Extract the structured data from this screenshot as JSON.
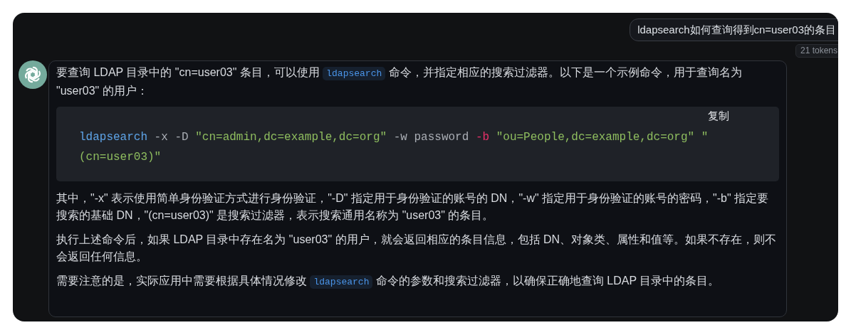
{
  "user_message": {
    "text": "ldapsearch如何查询得到cn=user03的条目",
    "tokens": "21 tokens"
  },
  "assistant_message": {
    "paragraphs_before": [
      [
        {
          "kind": "text",
          "text": "要查询 LDAP 目录中的 \"cn=user03\" 条目，可以使用 "
        },
        {
          "kind": "code",
          "text": "ldapsearch"
        },
        {
          "kind": "text",
          "text": " 命令，并指定相应的搜索过滤器。以下是一个示例命令，用于查询名为 \"user03\" 的用户："
        }
      ]
    ],
    "code_block": {
      "copy_label": "复制",
      "tokens": [
        {
          "kind": "command",
          "text": "ldapsearch"
        },
        {
          "kind": "plain",
          "text": " -x -D "
        },
        {
          "kind": "string",
          "text": "\"cn=admin,dc=example,dc=org\""
        },
        {
          "kind": "plain",
          "text": " -w password "
        },
        {
          "kind": "flag",
          "text": "-b"
        },
        {
          "kind": "string",
          "text": " \"ou=People,dc=example,dc=org\""
        },
        {
          "kind": "string",
          "text": " \"(cn=user03)\""
        }
      ]
    },
    "paragraphs_after": [
      [
        {
          "kind": "text",
          "text": "其中，\"-x\" 表示使用简单身份验证方式进行身份验证，\"-D\" 指定用于身份验证的账号的 DN，\"-w\" 指定用于身份验证的账号的密码，\"-b\" 指定要搜索的基础 DN，\"(cn=user03)\" 是搜索过滤器，表示搜索通用名称为 \"user03\" 的条目。"
        }
      ],
      [
        {
          "kind": "text",
          "text": "执行上述命令后，如果 LDAP 目录中存在名为 \"user03\" 的用户，就会返回相应的条目信息，包括 DN、对象类、属性和值等。如果不存在，则不会返回任何信息。"
        }
      ],
      [
        {
          "kind": "text",
          "text": "需要注意的是，实际应用中需要根据具体情况修改 "
        },
        {
          "kind": "code",
          "text": "ldapsearch"
        },
        {
          "kind": "text",
          "text": " 命令的参数和搜索过滤器，以确保正确地查询 LDAP 目录中的条目。"
        }
      ]
    ]
  }
}
